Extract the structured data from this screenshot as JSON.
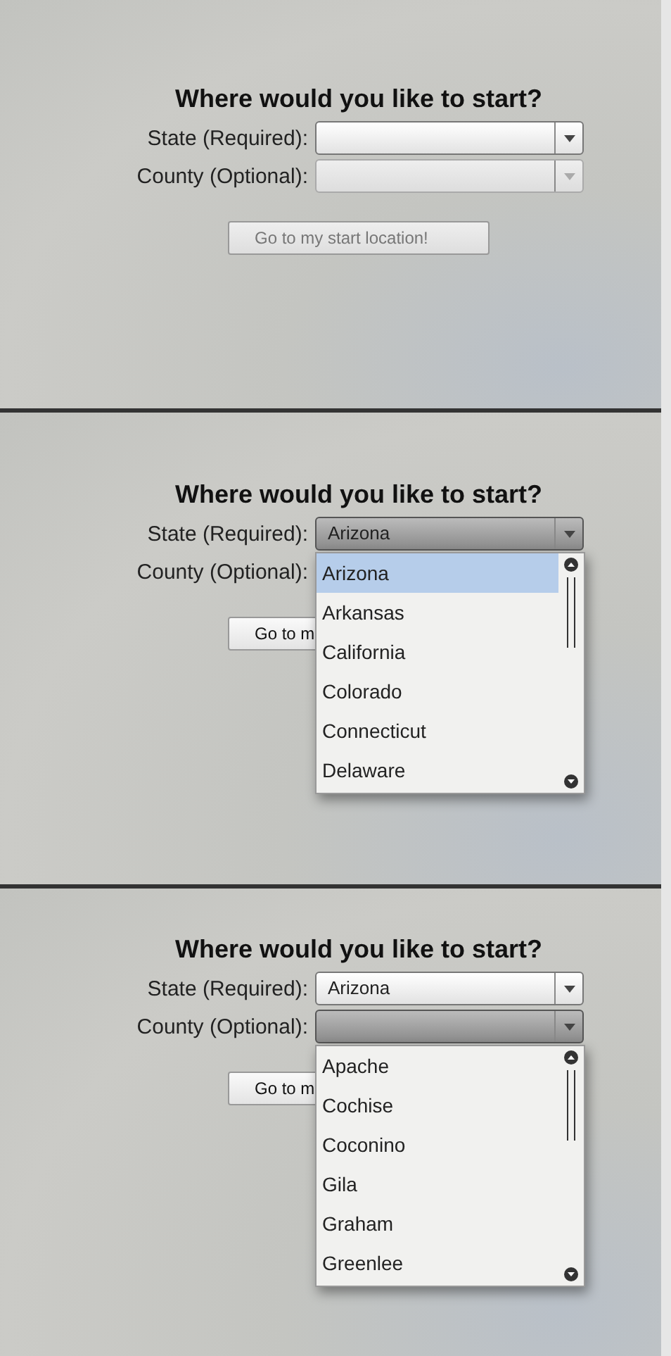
{
  "panels": [
    {
      "heading": "Where would you like to start?",
      "fields": [
        {
          "label": "State (Required):",
          "disabled": false,
          "expanded": false
        },
        {
          "label": "County (Optional):",
          "disabled": true,
          "expanded": false
        }
      ],
      "button": {
        "label": "Go to my start location!",
        "disabled": true
      }
    },
    {
      "heading": "Where would you like to start?",
      "fields": [
        {
          "label": "State (Required):",
          "value": "Arizona",
          "disabled": false,
          "expanded": true,
          "options": [
            {
              "label": "Arizona",
              "selected": true
            },
            {
              "label": "Arkansas",
              "selected": false
            },
            {
              "label": "California",
              "selected": false
            },
            {
              "label": "Colorado",
              "selected": false
            },
            {
              "label": "Connecticut",
              "selected": false
            },
            {
              "label": "Delaware",
              "selected": false
            }
          ]
        },
        {
          "label": "County (Optional):",
          "disabled": false
        }
      ],
      "button": {
        "label": "Go to m",
        "disabled": false
      }
    },
    {
      "heading": "Where would you like to start?",
      "fields": [
        {
          "label": "State (Required):",
          "value": "Arizona",
          "disabled": false,
          "expanded": false
        },
        {
          "label": "County (Optional):",
          "disabled": false,
          "expanded": true,
          "options": [
            {
              "label": "Apache",
              "selected": false
            },
            {
              "label": "Cochise",
              "selected": false
            },
            {
              "label": "Coconino",
              "selected": false
            },
            {
              "label": "Gila",
              "selected": false
            },
            {
              "label": "Graham",
              "selected": false
            },
            {
              "label": "Greenlee",
              "selected": false
            }
          ]
        }
      ],
      "button": {
        "label": "Go to m",
        "disabled": false
      }
    }
  ]
}
